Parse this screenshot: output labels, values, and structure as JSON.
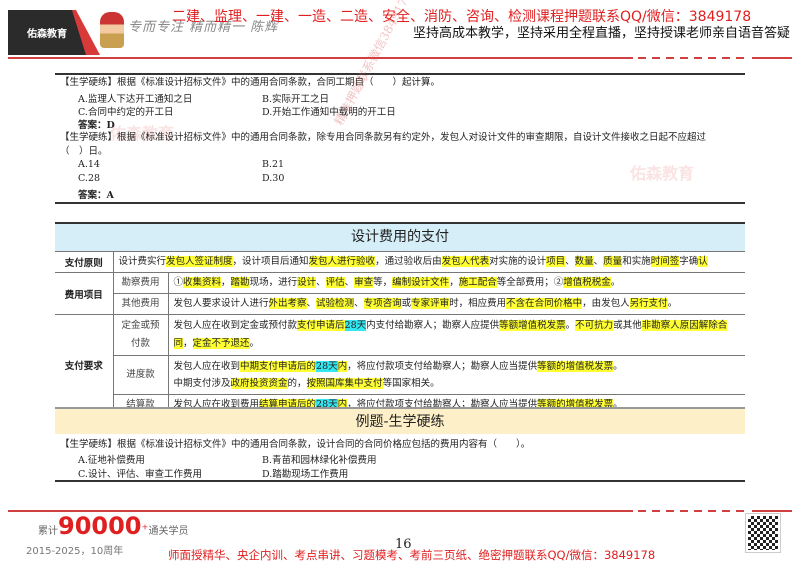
{
  "header": {
    "logo": "佑森教育",
    "signature": "专而专注 精而精一 陈辉",
    "ad": "二建、监理、一建、一造、二造、安全、消防、咨询、检测课程押题联系QQ/微信：3849178",
    "slogan": "坚持高成本教学，坚持采用全程直播，坚持授课老师亲自语音答疑"
  },
  "watermark": "精准押题联系微信3849178",
  "watermark_logo": "佑森教育",
  "questions": [
    {
      "stem": "【生学硬练】根据《标准设计招标文件》中的通用合同条款，合同工期自（　　）起计算。",
      "stem2": "",
      "options": [
        "A.监理人下达开工通知之日",
        "B.实际开工之日",
        "C.合同中约定的开工日",
        "D.开始工作通知中载明的开工日"
      ],
      "answer": "答案：D"
    },
    {
      "stem": "【生学硬练】根据《标准设计招标文件》中的通用合同条款，除专用合同条款另有约定外，发包人对设计文件的审查期限，自设计文件接收之日起不应超过",
      "stem2": "（　）日。",
      "options": [
        "A.14",
        "B.21",
        "C.28",
        "D.30"
      ],
      "answer": "答案：A"
    }
  ],
  "section_title": "设计费用的支付",
  "table": {
    "principle": {
      "label": "支付原则",
      "segs": [
        [
          "设计费实行",
          ""
        ],
        [
          "发包人签证制度",
          "y"
        ],
        [
          "，设计项目后通知",
          ""
        ],
        [
          "发包人进行验收",
          "y"
        ],
        [
          "，通过验收后由",
          ""
        ],
        [
          "发包人代表",
          "y"
        ],
        [
          "对实施的设计",
          ""
        ],
        [
          "项目",
          "y"
        ],
        [
          "、",
          ""
        ],
        [
          "数量",
          "y"
        ],
        [
          "、",
          ""
        ],
        [
          "质量",
          "y"
        ],
        [
          "和实施",
          ""
        ],
        [
          "时间签",
          "y"
        ],
        [
          "字确",
          ""
        ],
        [
          "认",
          "y"
        ]
      ]
    },
    "items_label": "费用项目",
    "survey": {
      "label": "勘察费用",
      "segs": [
        [
          "①",
          ""
        ],
        [
          "收集资料",
          "y"
        ],
        [
          "，",
          ""
        ],
        [
          "踏勘",
          "y"
        ],
        [
          "现场，进行",
          ""
        ],
        [
          "设计",
          "y"
        ],
        [
          "、",
          ""
        ],
        [
          "评估",
          "y"
        ],
        [
          "、",
          ""
        ],
        [
          "审查",
          "y"
        ],
        [
          "等，",
          ""
        ],
        [
          "编制设计文件",
          "y"
        ],
        [
          "，",
          ""
        ],
        [
          "施工配合",
          "y"
        ],
        [
          "等全部费用；②",
          ""
        ],
        [
          "增值税税金",
          "y"
        ],
        [
          "。",
          ""
        ]
      ]
    },
    "other": {
      "label": "其他费用",
      "segs": [
        [
          "发包人要求设计人进行",
          ""
        ],
        [
          "外出考察",
          "y"
        ],
        [
          "、",
          ""
        ],
        [
          "试验检测",
          "y"
        ],
        [
          "、",
          ""
        ],
        [
          "专项咨询",
          "y"
        ],
        [
          "或",
          ""
        ],
        [
          "专家评审",
          "y"
        ],
        [
          "时，相应费用",
          ""
        ],
        [
          "不含在合同价格中",
          "y"
        ],
        [
          "，由发包人",
          ""
        ],
        [
          "另行支付",
          "y"
        ],
        [
          "。",
          ""
        ]
      ]
    },
    "req_label": "支付要求",
    "deposit": {
      "label": "定金或预付款",
      "segs": [
        [
          "发包人应在收到定金或预付款",
          ""
        ],
        [
          "支付申请后",
          "y"
        ],
        [
          "28天",
          "c"
        ],
        [
          "内支付给勘察人；勘察人应提供",
          ""
        ],
        [
          "等额增值税发票",
          "y"
        ],
        [
          "。",
          ""
        ],
        [
          "不可抗力",
          "y"
        ],
        [
          "或其他",
          ""
        ],
        [
          "非勘察人原因解除合同",
          "y"
        ],
        [
          "，",
          ""
        ],
        [
          "定金不予退还",
          "y"
        ],
        [
          "。",
          ""
        ]
      ]
    },
    "progress": {
      "label": "进度款",
      "segs": [
        [
          "发包人应在收到",
          ""
        ],
        [
          "中期支付申请后的",
          "y"
        ],
        [
          "28天",
          "c"
        ],
        [
          "内",
          "y"
        ],
        [
          "，将应付款项支付给勘察人；勘察人应当提供",
          ""
        ],
        [
          "等额的增值税发票",
          "y"
        ],
        [
          "。",
          ""
        ]
      ],
      "segs2": [
        [
          "中期支付涉及",
          ""
        ],
        [
          "政府投资资金",
          "y"
        ],
        [
          "的，",
          ""
        ],
        [
          "按照国库集中支付",
          "y"
        ],
        [
          "等国家相关。",
          ""
        ]
      ]
    },
    "settle": {
      "label": "结算款",
      "segs": [
        [
          "发包人应在收到费用",
          ""
        ],
        [
          "结算申请后的",
          "y"
        ],
        [
          "28天",
          "c"
        ],
        [
          "内",
          "y"
        ],
        [
          "，将应付款项支付给勘察人；勘察人应当提供",
          ""
        ],
        [
          "等额的增值税发票",
          "y"
        ],
        [
          "。",
          ""
        ]
      ]
    }
  },
  "example_title": "例题-生学硬练",
  "question3": {
    "stem": "【生学硬练】根据《标准设计招标文件》中的通用合同条款，设计合同的合同价格应包括的费用内容有（　　）。",
    "options": [
      "A.征地补偿费用",
      "B.青苗和园林绿化补偿费用",
      "C.设计、评估、审查工作费用",
      "D.踏勘现场工作费用"
    ]
  },
  "footer": {
    "count_prefix": "累计",
    "count": "90000",
    "count_plus": "+",
    "count_suffix": "通关学员",
    "years": "2015-2025，10周年",
    "page": "16",
    "ad": "师面授精华、央企内训、考点串讲、习题模考、考前三页纸、绝密押题联系QQ/微信：3849178"
  }
}
